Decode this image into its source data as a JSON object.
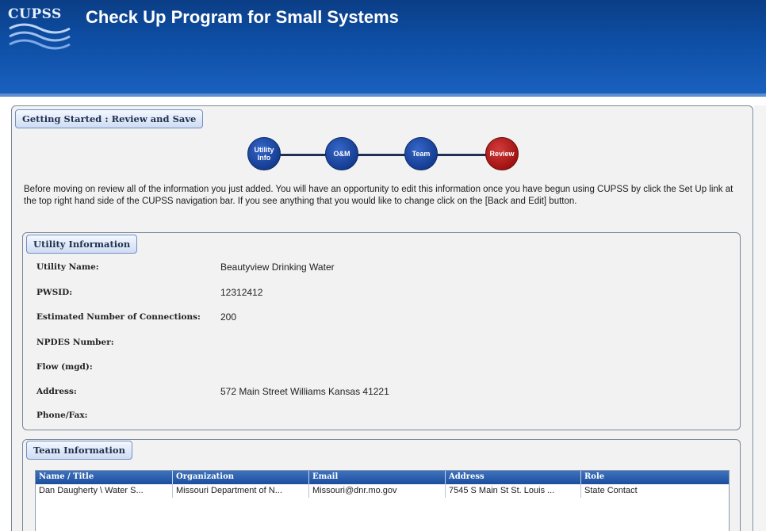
{
  "header": {
    "logo_text": "CUPSS",
    "title": "Check Up Program for Small Systems"
  },
  "page": {
    "section_title": "Getting Started : Review and Save",
    "steps": [
      {
        "label": "Utility Info",
        "active": false
      },
      {
        "label": "O&M",
        "active": false
      },
      {
        "label": "Team",
        "active": false
      },
      {
        "label": "Review",
        "active": true
      }
    ],
    "intro": "Before moving on review all of the information you just added. You will have an opportunity to edit this information once you have begun using CUPSS by click the Set Up link at the top right hand side of the CUPSS navigation bar. If you see anything that you would like to change click on the [Back and Edit] button."
  },
  "utility": {
    "title": "Utility Information",
    "fields": [
      {
        "label": "Utility Name:",
        "value": "Beautyview Drinking Water"
      },
      {
        "label": "PWSID:",
        "value": "12312412"
      },
      {
        "label": "Estimated Number of Connections:",
        "value": "200"
      },
      {
        "label": "NPDES Number:",
        "value": ""
      },
      {
        "label": "Flow (mgd):",
        "value": ""
      },
      {
        "label": "Address:",
        "value": "572 Main Street Williams Kansas 41221"
      },
      {
        "label": "Phone/Fax:",
        "value": ""
      }
    ]
  },
  "team": {
    "title": "Team Information",
    "columns": [
      "Name / Title",
      "Organization",
      "Email",
      "Address",
      "Role"
    ],
    "rows": [
      [
        "Dan Daugherty \\ Water S...",
        "Missouri Department of N...",
        "Missouri@dnr.mo.gov",
        "7545 S Main St St. Louis ...",
        "State Contact"
      ]
    ]
  },
  "colors": {
    "header_blue": "#0d4da3",
    "step_blue": "#133a8e",
    "step_active_red": "#9e1010"
  }
}
